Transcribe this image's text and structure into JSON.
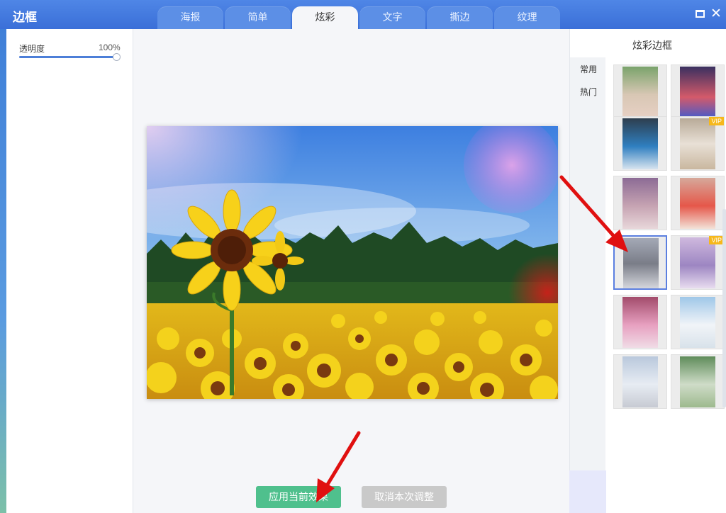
{
  "window": {
    "title": "边框"
  },
  "tabs": [
    {
      "label": "海报"
    },
    {
      "label": "简单"
    },
    {
      "label": "炫彩"
    },
    {
      "label": "文字"
    },
    {
      "label": "撕边"
    },
    {
      "label": "纹理"
    }
  ],
  "left_panel": {
    "opacity_label": "透明度",
    "opacity_value": "100%",
    "opacity_level": 1.0
  },
  "right_panel": {
    "title": "炫彩边框",
    "categories": [
      {
        "label": "常用"
      },
      {
        "label": "热门"
      }
    ],
    "vip_label": "VIP"
  },
  "buttons": {
    "apply": "应用当前效果",
    "cancel": "取消本次调整"
  },
  "colors": {
    "accent": "#3a6fd8",
    "apply": "#4fc08d",
    "cancel": "#c9c9c9",
    "vip": "#f6b81b",
    "arrow": "#e01010"
  }
}
